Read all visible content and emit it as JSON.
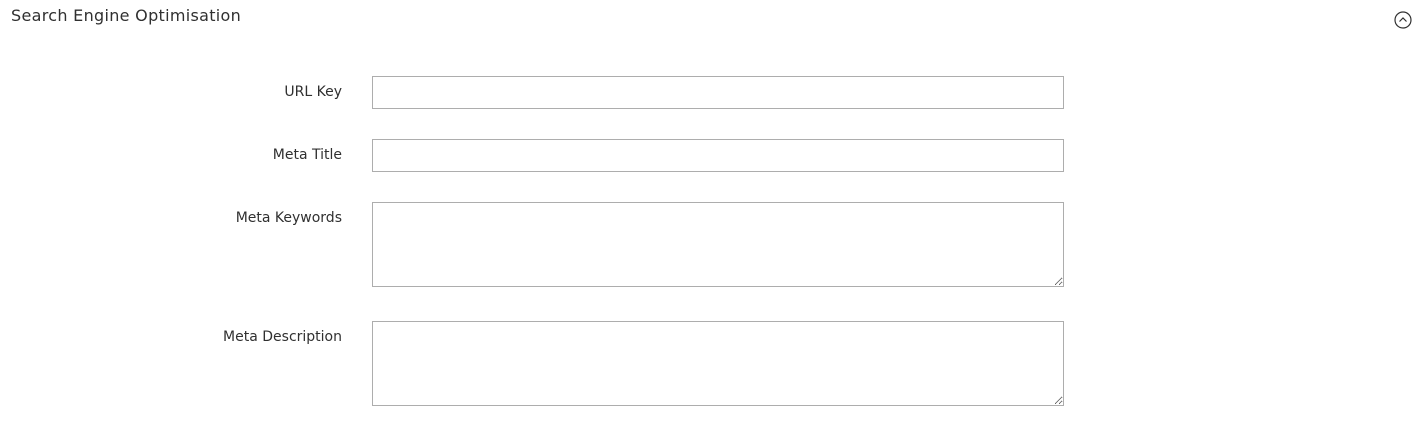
{
  "section": {
    "title": "Search Engine Optimisation"
  },
  "fields": {
    "url_key": {
      "label": "URL Key",
      "value": "",
      "placeholder": ""
    },
    "meta_title": {
      "label": "Meta Title",
      "value": "",
      "placeholder": ""
    },
    "meta_keywords": {
      "label": "Meta Keywords",
      "value": "",
      "placeholder": ""
    },
    "meta_description": {
      "label": "Meta Description",
      "value": "",
      "placeholder": ""
    }
  },
  "icons": {
    "collapse": "chevron-up-circle-icon"
  },
  "colors": {
    "text": "#303030",
    "border": "#adadad",
    "background": "#ffffff"
  }
}
